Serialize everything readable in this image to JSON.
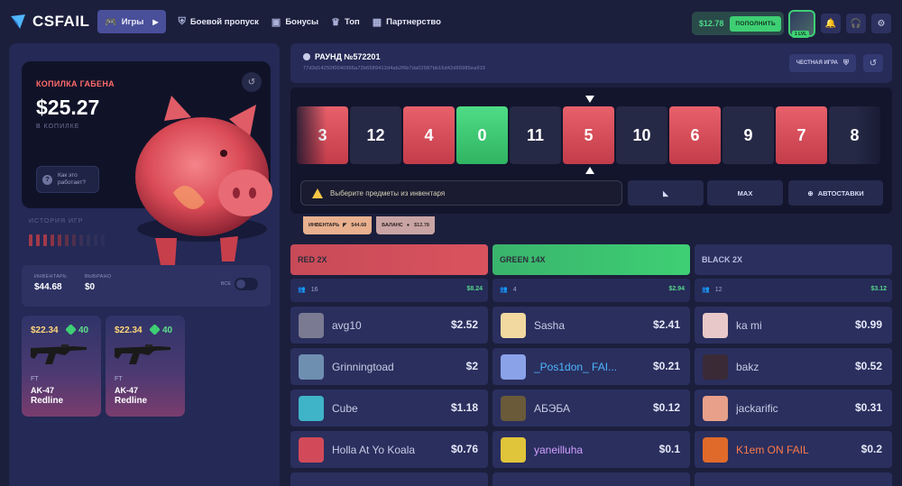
{
  "brand": {
    "logo_text": "CSFAIL"
  },
  "nav": {
    "games": "Игры",
    "battlepass": "Боевой пропуск",
    "bonuses": "Бонусы",
    "top": "Топ",
    "partnership": "Партнерство"
  },
  "account": {
    "balance": "$12.78",
    "deposit_label": "ПОПОЛНИТЬ",
    "level": "1 LVL"
  },
  "piggy": {
    "title": "КОПИЛКА ГАБЕНА",
    "amount": "$25.27",
    "subtitle": "В КОПИЛКЕ",
    "how_label": "Как это работает?"
  },
  "history": {
    "label": "ИСТОРИЯ ИГР"
  },
  "stats": {
    "inventory_label": "ИНВЕНТАРЬ",
    "inventory_value": "$44.68",
    "chosen_label": "ВЫБРАНО",
    "chosen_value": "$0",
    "all_label": "ВСЕ"
  },
  "items": [
    {
      "price": "$22.34",
      "points": "40",
      "quality": "FT",
      "weapon": "AK-47",
      "skin": "Redline"
    },
    {
      "price": "$22.34",
      "points": "40",
      "quality": "FT",
      "weapon": "AK-47",
      "skin": "Redline"
    }
  ],
  "round": {
    "title": "РАУНД №572201",
    "hash": "77d3d14250f0040966a72b6589412d4ab2f6b7da02987bb16d42d65985ea915",
    "fair_label": "ЧЕСТНАЯ ИГРА"
  },
  "roulette": {
    "tiles": [
      {
        "n": "3",
        "c": "red"
      },
      {
        "n": "12",
        "c": "black"
      },
      {
        "n": "4",
        "c": "red"
      },
      {
        "n": "0",
        "c": "green"
      },
      {
        "n": "11",
        "c": "black"
      },
      {
        "n": "5",
        "c": "red"
      },
      {
        "n": "10",
        "c": "black"
      },
      {
        "n": "6",
        "c": "red"
      },
      {
        "n": "9",
        "c": "black"
      },
      {
        "n": "7",
        "c": "red"
      },
      {
        "n": "8",
        "c": "black"
      }
    ],
    "placeholder": "Выберите предметы из инвентаря",
    "max_label": "MAX",
    "auto_label": "АВТОСТАВКИ"
  },
  "chips": {
    "inventory_label": "ИНВЕНТАРЬ",
    "inventory_value": "$44.68",
    "balance_label": "БАЛАНС",
    "balance_value": "$12.78"
  },
  "columns": [
    {
      "title": "RED 2X",
      "players": "16",
      "total": "$8.24",
      "color": "#d9535e",
      "bets": [
        {
          "name": "avg10",
          "amount": "$2.52"
        },
        {
          "name": "Grinningtoad",
          "amount": "$2"
        },
        {
          "name": "Cube",
          "amount": "$1.18"
        },
        {
          "name": "Holla At Yo Koala",
          "amount": "$0.76"
        }
      ]
    },
    {
      "title": "GREEN 14X",
      "players": "4",
      "total": "$2.94",
      "color": "#3ecf74",
      "bets": [
        {
          "name": "Sasha",
          "amount": "$2.41"
        },
        {
          "name": "_Pos1don_ FAI...",
          "amount": "$0.21"
        },
        {
          "name": "АБЭБА",
          "amount": "$0.12"
        },
        {
          "name": "yaneilluha",
          "amount": "$0.1"
        }
      ]
    },
    {
      "title": "BLACK 2X",
      "players": "12",
      "total": "$3.12",
      "color": "#2a2f5e",
      "bets": [
        {
          "name": "ka mi",
          "amount": "$0.99"
        },
        {
          "name": "bakz",
          "amount": "$0.52"
        },
        {
          "name": "jackarific",
          "amount": "$0.31"
        },
        {
          "name": "K1em ON FAIL",
          "amount": "$0.2"
        }
      ]
    }
  ]
}
